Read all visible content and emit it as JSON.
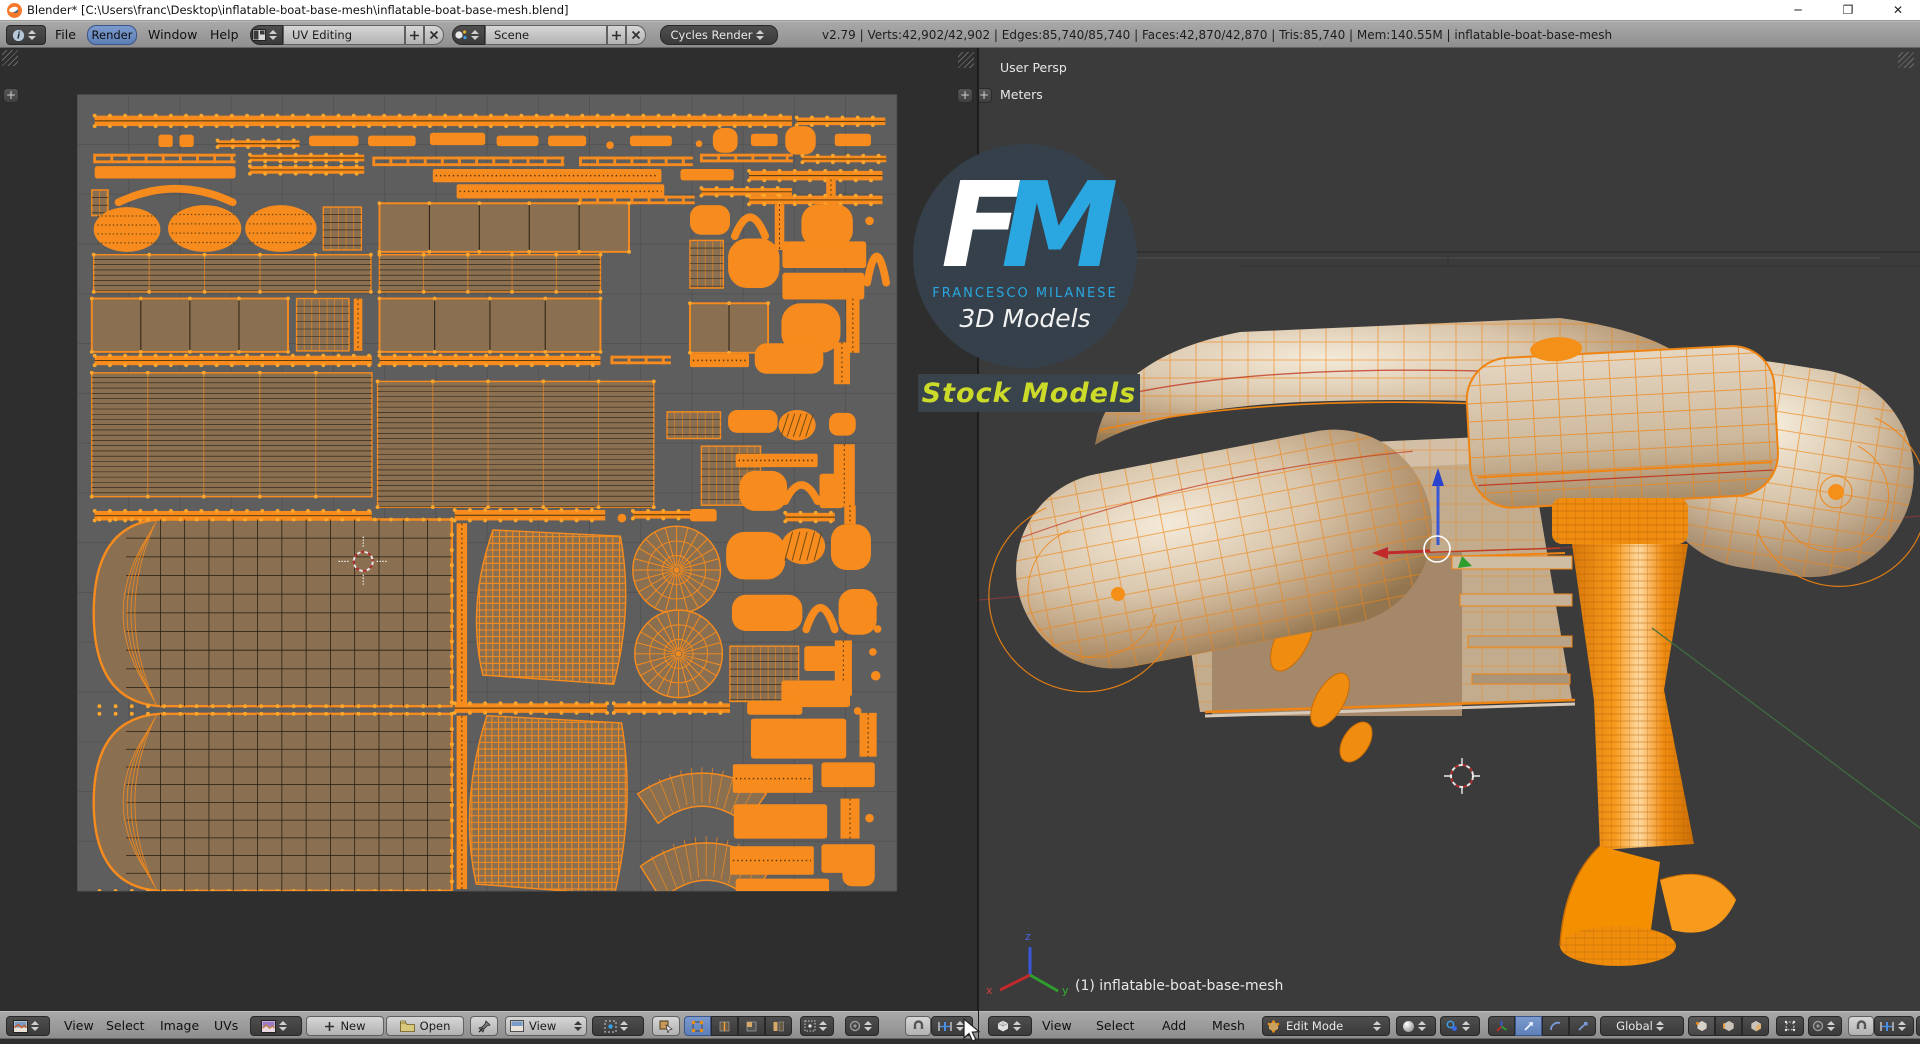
{
  "title_bar": {
    "title": "Blender* [C:\\Users\\franc\\Desktop\\inflatable-boat-base-mesh\\inflatable-boat-base-mesh.blend]",
    "minimize": "─",
    "maximize": "❐",
    "close": "✕"
  },
  "top_header": {
    "menu_file": "File",
    "menu_render": "Render",
    "menu_window": "Window",
    "menu_help": "Help",
    "layout_name": "UV Editing",
    "scene_name": "Scene",
    "engine": "Cycles Render",
    "stats": "v2.79 | Verts:42,902/42,902 | Edges:85,740/85,740 | Faces:42,870/42,870 | Tris:85,740 | Mem:140.55M | inflatable-boat-base-mesh",
    "add_label": "+",
    "close_label": "✕"
  },
  "uv_header": {
    "menu_view": "View",
    "menu_select": "Select",
    "menu_image": "Image",
    "menu_uvs": "UVs",
    "new_label": "New",
    "open_label": "Open",
    "view_dropdown": "View",
    "new_plus": "+"
  },
  "vp_header": {
    "menu_view": "View",
    "menu_select": "Select",
    "menu_add": "Add",
    "menu_mesh": "Mesh",
    "mode": "Edit Mode",
    "orientation": "Global"
  },
  "viewport": {
    "view_label": "User Persp",
    "units_label": "Meters",
    "object_label": "(1) inflatable-boat-base-mesh",
    "axis_x": "x",
    "axis_y": "y",
    "axis_z": "z"
  },
  "logo": {
    "letter_f": "F",
    "letter_m": "M",
    "name": "FRANCESCO MILANESE",
    "subtitle": "3D Models",
    "badge": "Stock Models"
  },
  "colors": {
    "accent_orange": "#f78b1d",
    "face_tan": "#8a7050",
    "canvas_gray": "#5e5e5e",
    "viewport_gray": "#3b3b3b",
    "logo_blue": "#2aa7e0",
    "badge_yellow": "#ccda29",
    "select_blue": "#5e80b8"
  },
  "uv_islands": [
    [
      "strip",
      75,
      119,
      732,
      11
    ],
    [
      "strip",
      812,
      121,
      93,
      8
    ],
    [
      "bar",
      142,
      139,
      15,
      13
    ],
    [
      "bar",
      164,
      139,
      15,
      13
    ],
    [
      "strip",
      204,
      145,
      86,
      7
    ],
    [
      "bar",
      300,
      140,
      52,
      11
    ],
    [
      "bar",
      362,
      140,
      50,
      11
    ],
    [
      "bar",
      427,
      137,
      58,
      13
    ],
    [
      "bar",
      497,
      140,
      44,
      11
    ],
    [
      "bar",
      551,
      140,
      40,
      11
    ],
    [
      "dot",
      612,
      146,
      8,
      8
    ],
    [
      "bar",
      637,
      140,
      44,
      11
    ],
    [
      "dot",
      706,
      145,
      7,
      7
    ],
    [
      "blob",
      724,
      132,
      26,
      26
    ],
    [
      "bar",
      764,
      138,
      28,
      13
    ],
    [
      "blob",
      800,
      130,
      32,
      30
    ],
    [
      "bar",
      852,
      138,
      38,
      13
    ],
    [
      "dstrip",
      75,
      159,
      148,
      10
    ],
    [
      "strip",
      238,
      160,
      120,
      7
    ],
    [
      "dstrip",
      368,
      162,
      200,
      10
    ],
    [
      "dstrip",
      585,
      162,
      118,
      10
    ],
    [
      "dstrip",
      712,
      159,
      96,
      9
    ],
    [
      "strip",
      818,
      161,
      88,
      7
    ],
    [
      "bar",
      75,
      172,
      148,
      13
    ],
    [
      "strip",
      238,
      172,
      120,
      8
    ],
    [
      "hatch",
      430,
      175,
      240,
      14
    ],
    [
      "bar",
      690,
      175,
      56,
      12
    ],
    [
      "strip",
      762,
      177,
      140,
      10
    ],
    [
      "arc",
      100,
      186,
      120,
      30
    ],
    [
      "hatch",
      455,
      191,
      218,
      15
    ],
    [
      "dstrip",
      585,
      203,
      120,
      9
    ],
    [
      "strip",
      712,
      195,
      95,
      8
    ],
    [
      "vstrip",
      843,
      186,
      10,
      28
    ],
    [
      "strip",
      762,
      203,
      140,
      9
    ],
    [
      "grid",
      72,
      197,
      17,
      27
    ],
    [
      "oval",
      74,
      215,
      70,
      47
    ],
    [
      "oval",
      152,
      213,
      77,
      49
    ],
    [
      "oval",
      233,
      213,
      75,
      49
    ],
    [
      "grid",
      315,
      215,
      40,
      45
    ],
    [
      "panel",
      374,
      211,
      262,
      51
    ],
    [
      "blob",
      700,
      213,
      42,
      31
    ],
    [
      "arc",
      747,
      212,
      32,
      42
    ],
    [
      "vstrip",
      789,
      212,
      10,
      48
    ],
    [
      "blob",
      817,
      212,
      54,
      45
    ],
    [
      "dot",
      884,
      225,
      9,
      9
    ],
    [
      "slats",
      74,
      265,
      291,
      39
    ],
    [
      "slats",
      374,
      265,
      232,
      39
    ],
    [
      "grid",
      700,
      250,
      35,
      50
    ],
    [
      "blob",
      740,
      248,
      54,
      52
    ],
    [
      "bar",
      797,
      251,
      88,
      28
    ],
    [
      "arc",
      886,
      248,
      20,
      58
    ],
    [
      "bar",
      797,
      284,
      86,
      28
    ],
    [
      "panel",
      72,
      311,
      206,
      56
    ],
    [
      "grid",
      287,
      311,
      55,
      55
    ],
    [
      "vstrip",
      347,
      311,
      9,
      55
    ],
    [
      "panel",
      374,
      311,
      232,
      56
    ],
    [
      "panel",
      700,
      316,
      82,
      52
    ],
    [
      "blob",
      796,
      316,
      62,
      52
    ],
    [
      "vstrip",
      864,
      311,
      14,
      57
    ],
    [
      "strip",
      75,
      371,
      291,
      10
    ],
    [
      "strip",
      374,
      371,
      232,
      10
    ],
    [
      "dstrip",
      618,
      371,
      62,
      9
    ],
    [
      "hatch",
      700,
      369,
      62,
      14
    ],
    [
      "blob",
      768,
      358,
      72,
      32
    ],
    [
      "vstrip",
      851,
      357,
      17,
      44
    ],
    [
      "slats",
      72,
      389,
      294,
      130
    ],
    [
      "slats",
      372,
      398,
      290,
      132
    ],
    [
      "grid",
      676,
      430,
      56,
      28
    ],
    [
      "blob",
      740,
      428,
      52,
      24
    ],
    [
      "hatch2",
      793,
      428,
      39,
      32
    ],
    [
      "blob",
      846,
      431,
      28,
      24
    ],
    [
      "grid",
      712,
      466,
      62,
      62
    ],
    [
      "hatch",
      748,
      474,
      86,
      14
    ],
    [
      "blob",
      752,
      492,
      50,
      42
    ],
    [
      "vstrip",
      851,
      464,
      22,
      66
    ],
    [
      "arc",
      800,
      495,
      34,
      36
    ],
    [
      "bar",
      836,
      495,
      25,
      36
    ],
    [
      "strip",
      75,
      534,
      291,
      10
    ],
    [
      "strip",
      453,
      533,
      158,
      11
    ],
    [
      "dot",
      624,
      537,
      9,
      9
    ],
    [
      "strip",
      640,
      534,
      62,
      8
    ],
    [
      "bar",
      700,
      532,
      28,
      13
    ],
    [
      "strip",
      800,
      536,
      52,
      9
    ],
    [
      "vstrip",
      862,
      528,
      12,
      20
    ],
    [
      "tube",
      74,
      543,
      376,
      196
    ],
    [
      "tube",
      74,
      747,
      376,
      186
    ],
    [
      "vstrip",
      455,
      547,
      11,
      190
    ],
    [
      "vstrip",
      455,
      749,
      11,
      182
    ],
    [
      "skirt",
      465,
      554,
      176,
      162
    ],
    [
      "skirt",
      457,
      749,
      186,
      188
    ],
    [
      "disc",
      640,
      550,
      92,
      92
    ],
    [
      "disc",
      642,
      638,
      92,
      92
    ],
    [
      "blob",
      738,
      556,
      62,
      50
    ],
    [
      "hatch2",
      796,
      552,
      46,
      38
    ],
    [
      "blob",
      848,
      548,
      42,
      48
    ],
    [
      "blob",
      744,
      622,
      74,
      38
    ],
    [
      "arc",
      822,
      620,
      30,
      48
    ],
    [
      "blob",
      856,
      616,
      40,
      48
    ],
    [
      "dot",
      889,
      628,
      8,
      8
    ],
    [
      "dot",
      893,
      654,
      8,
      8
    ],
    [
      "grid",
      742,
      676,
      72,
      58
    ],
    [
      "bar",
      820,
      676,
      46,
      26
    ],
    [
      "vstrip",
      852,
      670,
      18,
      58
    ],
    [
      "dot",
      888,
      678,
      8,
      8
    ],
    [
      "dot",
      890,
      702,
      10,
      10
    ],
    [
      "bar",
      796,
      712,
      72,
      28
    ],
    [
      "strip",
      453,
      736,
      160,
      10
    ],
    [
      "strip",
      620,
      736,
      122,
      10
    ],
    [
      "bar",
      760,
      734,
      58,
      14
    ],
    [
      "dot",
      872,
      740,
      8,
      8
    ],
    [
      "bar",
      764,
      752,
      100,
      42
    ],
    [
      "vstrip",
      878,
      746,
      18,
      46
    ],
    [
      "arcband",
      645,
      800,
      135,
      62
    ],
    [
      "arcband",
      648,
      872,
      138,
      70
    ],
    [
      "hatch",
      745,
      800,
      84,
      30
    ],
    [
      "bar",
      838,
      798,
      56,
      26
    ],
    [
      "bar",
      746,
      842,
      98,
      36
    ],
    [
      "vstrip",
      858,
      836,
      20,
      42
    ],
    [
      "dot",
      884,
      852,
      9,
      9
    ],
    [
      "hatch",
      742,
      886,
      88,
      30
    ],
    [
      "bar",
      838,
      884,
      56,
      30
    ],
    [
      "bar",
      748,
      920,
      98,
      24
    ],
    [
      "blob",
      860,
      902,
      34,
      26
    ]
  ]
}
